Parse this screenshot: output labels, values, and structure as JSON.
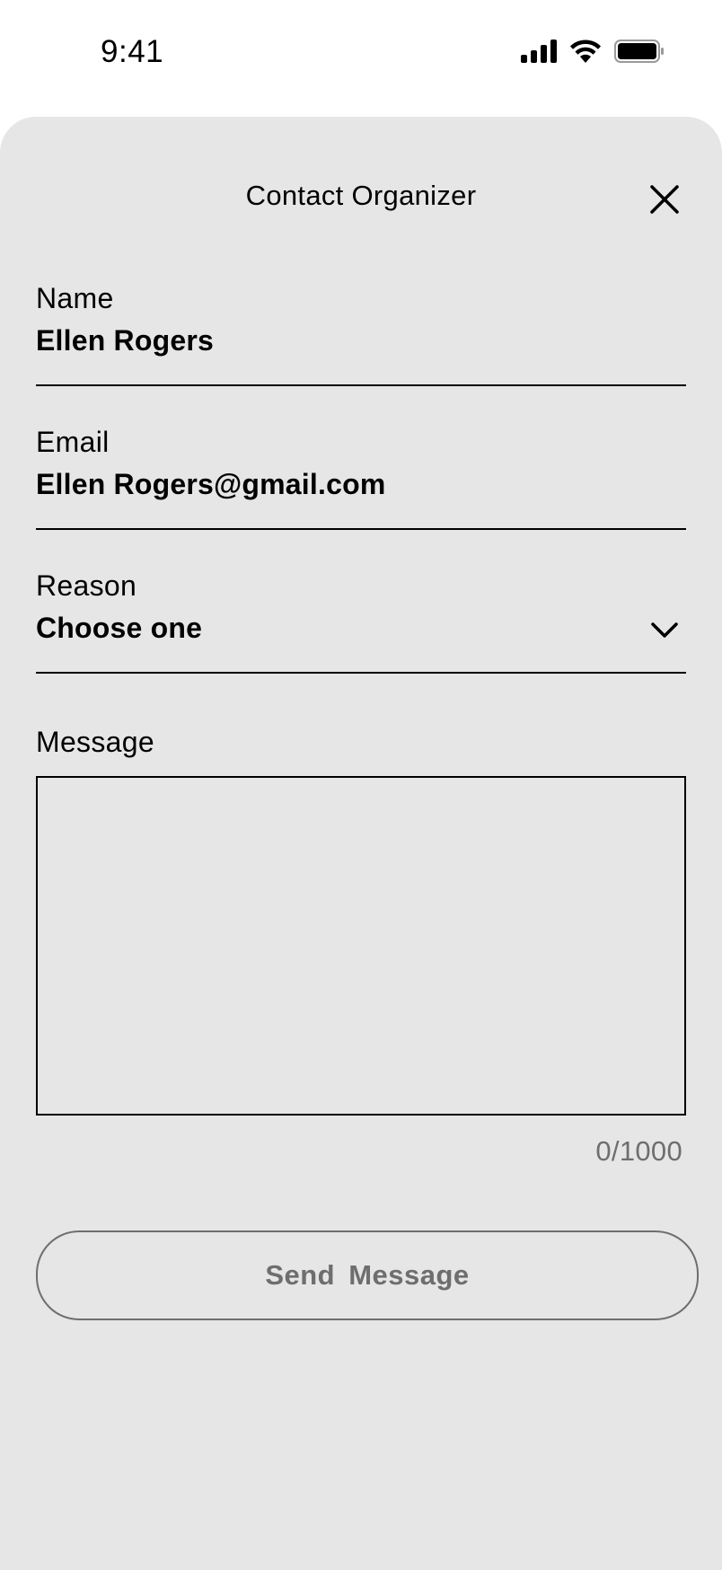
{
  "status_bar": {
    "time": "9:41",
    "icons": [
      "cellular-signal-icon",
      "wifi-icon",
      "battery-icon"
    ]
  },
  "sheet": {
    "title": "Contact Organizer",
    "close_icon": "close-icon",
    "background": "#e6e6e6"
  },
  "form": {
    "name": {
      "label": "Name",
      "value": "Ellen Rogers"
    },
    "email": {
      "label": "Email",
      "value": "Ellen Rogers@gmail.com"
    },
    "reason": {
      "label": "Reason",
      "value": "Choose one",
      "icon": "chevron-down-icon"
    },
    "message": {
      "label": "Message",
      "value": "",
      "counter": "0/1000"
    },
    "submit": {
      "label": "Send  Message"
    }
  },
  "colors": {
    "text": "#000000",
    "muted": "#6e6e6e",
    "sheet": "#e6e6e6"
  }
}
